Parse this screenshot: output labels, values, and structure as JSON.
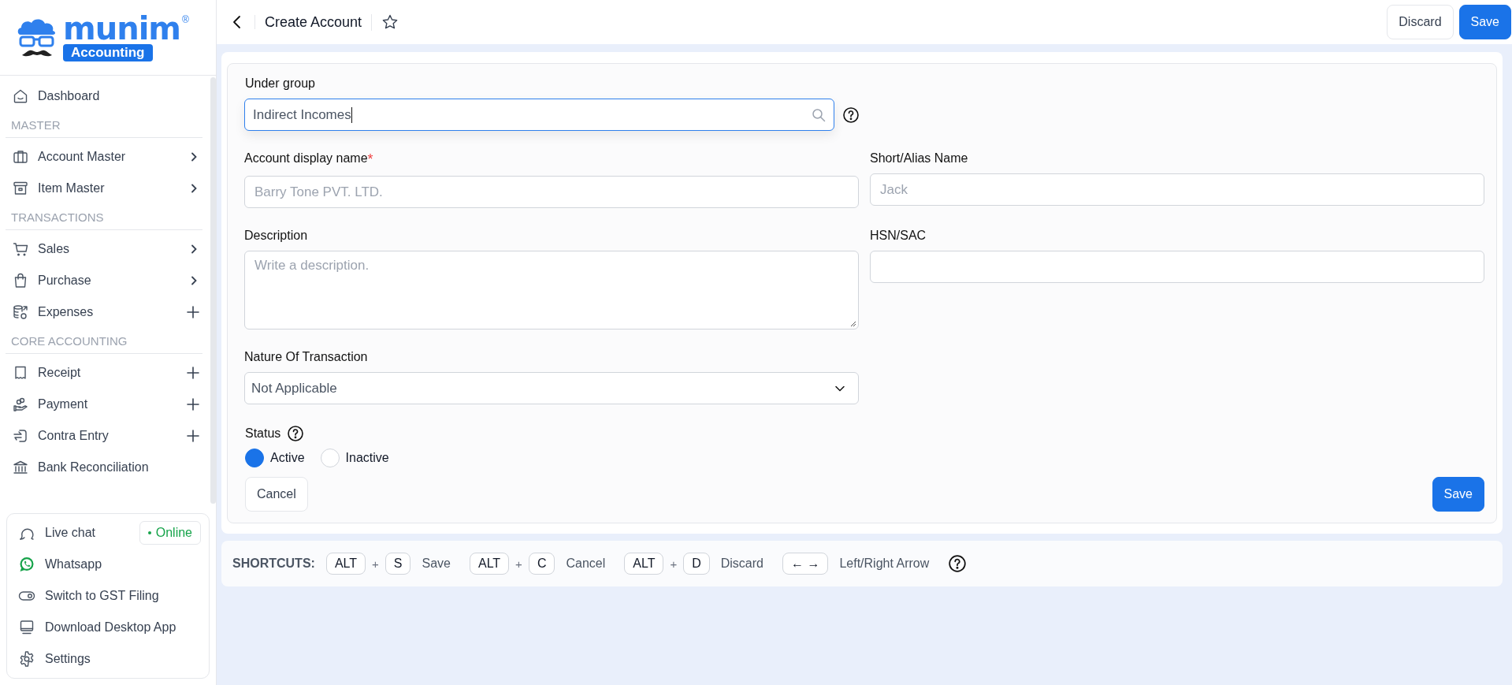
{
  "logo": {
    "name": "munim",
    "mark": "®",
    "badge": "Accounting"
  },
  "sidebar": {
    "items": [
      {
        "kind": "link",
        "label": "Dashboard"
      },
      {
        "kind": "heading",
        "label": "MASTER"
      },
      {
        "kind": "submenu",
        "label": "Account Master"
      },
      {
        "kind": "submenu",
        "label": "Item Master"
      },
      {
        "kind": "heading",
        "label": "TRANSACTIONS"
      },
      {
        "kind": "submenu",
        "label": "Sales"
      },
      {
        "kind": "submenu",
        "label": "Purchase"
      },
      {
        "kind": "add",
        "label": "Expenses"
      },
      {
        "kind": "heading",
        "label": "CORE ACCOUNTING"
      },
      {
        "kind": "add",
        "label": "Receipt"
      },
      {
        "kind": "add",
        "label": "Payment"
      },
      {
        "kind": "add",
        "label": "Contra Entry"
      },
      {
        "kind": "link",
        "label": "Bank Reconciliation"
      }
    ],
    "support": [
      {
        "label": "Live chat",
        "badge": "Online"
      },
      {
        "label": "Whatsapp"
      },
      {
        "label": "Switch to GST Filing"
      },
      {
        "label": "Download Desktop App"
      },
      {
        "label": "Settings"
      }
    ]
  },
  "header": {
    "title": "Create Account",
    "buttons": [
      {
        "kind": "secondary",
        "label": "Discard"
      },
      {
        "kind": "primary",
        "label": "Save"
      }
    ]
  },
  "form": {
    "under_group": {
      "label": "Under group",
      "value": "Indirect Incomes",
      "focused": true
    },
    "rows": [
      [
        {
          "kind": "text",
          "label": "Account display name",
          "required_mark": "*",
          "placeholder": "Barry Tone PVT. LTD."
        },
        {
          "kind": "text",
          "label": "Short/Alias Name",
          "placeholder": "Jack"
        }
      ],
      [
        {
          "kind": "textarea",
          "label": "Description",
          "placeholder": "Write a description."
        },
        {
          "kind": "text",
          "label": "HSN/SAC"
        }
      ],
      [
        {
          "kind": "select",
          "label": "Nature Of Transaction",
          "value": "Not Applicable"
        }
      ]
    ],
    "status": {
      "label": "Status",
      "options": [
        {
          "label": "Active",
          "selected": true
        },
        {
          "label": "Inactive",
          "selected": false
        }
      ]
    },
    "cancel_button": "Cancel",
    "save_button": "Save"
  },
  "shortcuts": {
    "label": "SHORTCUTS:",
    "items": [
      {
        "keys": [
          "ALT",
          "S"
        ],
        "joiner": "+",
        "action": "Save"
      },
      {
        "keys": [
          "ALT",
          "C"
        ],
        "joiner": "+",
        "action": "Cancel"
      },
      {
        "keys": [
          "ALT",
          "D"
        ],
        "joiner": "+",
        "action": "Discard"
      },
      {
        "keys": [
          "← →"
        ],
        "action": "Left/Right Arrow"
      }
    ]
  }
}
